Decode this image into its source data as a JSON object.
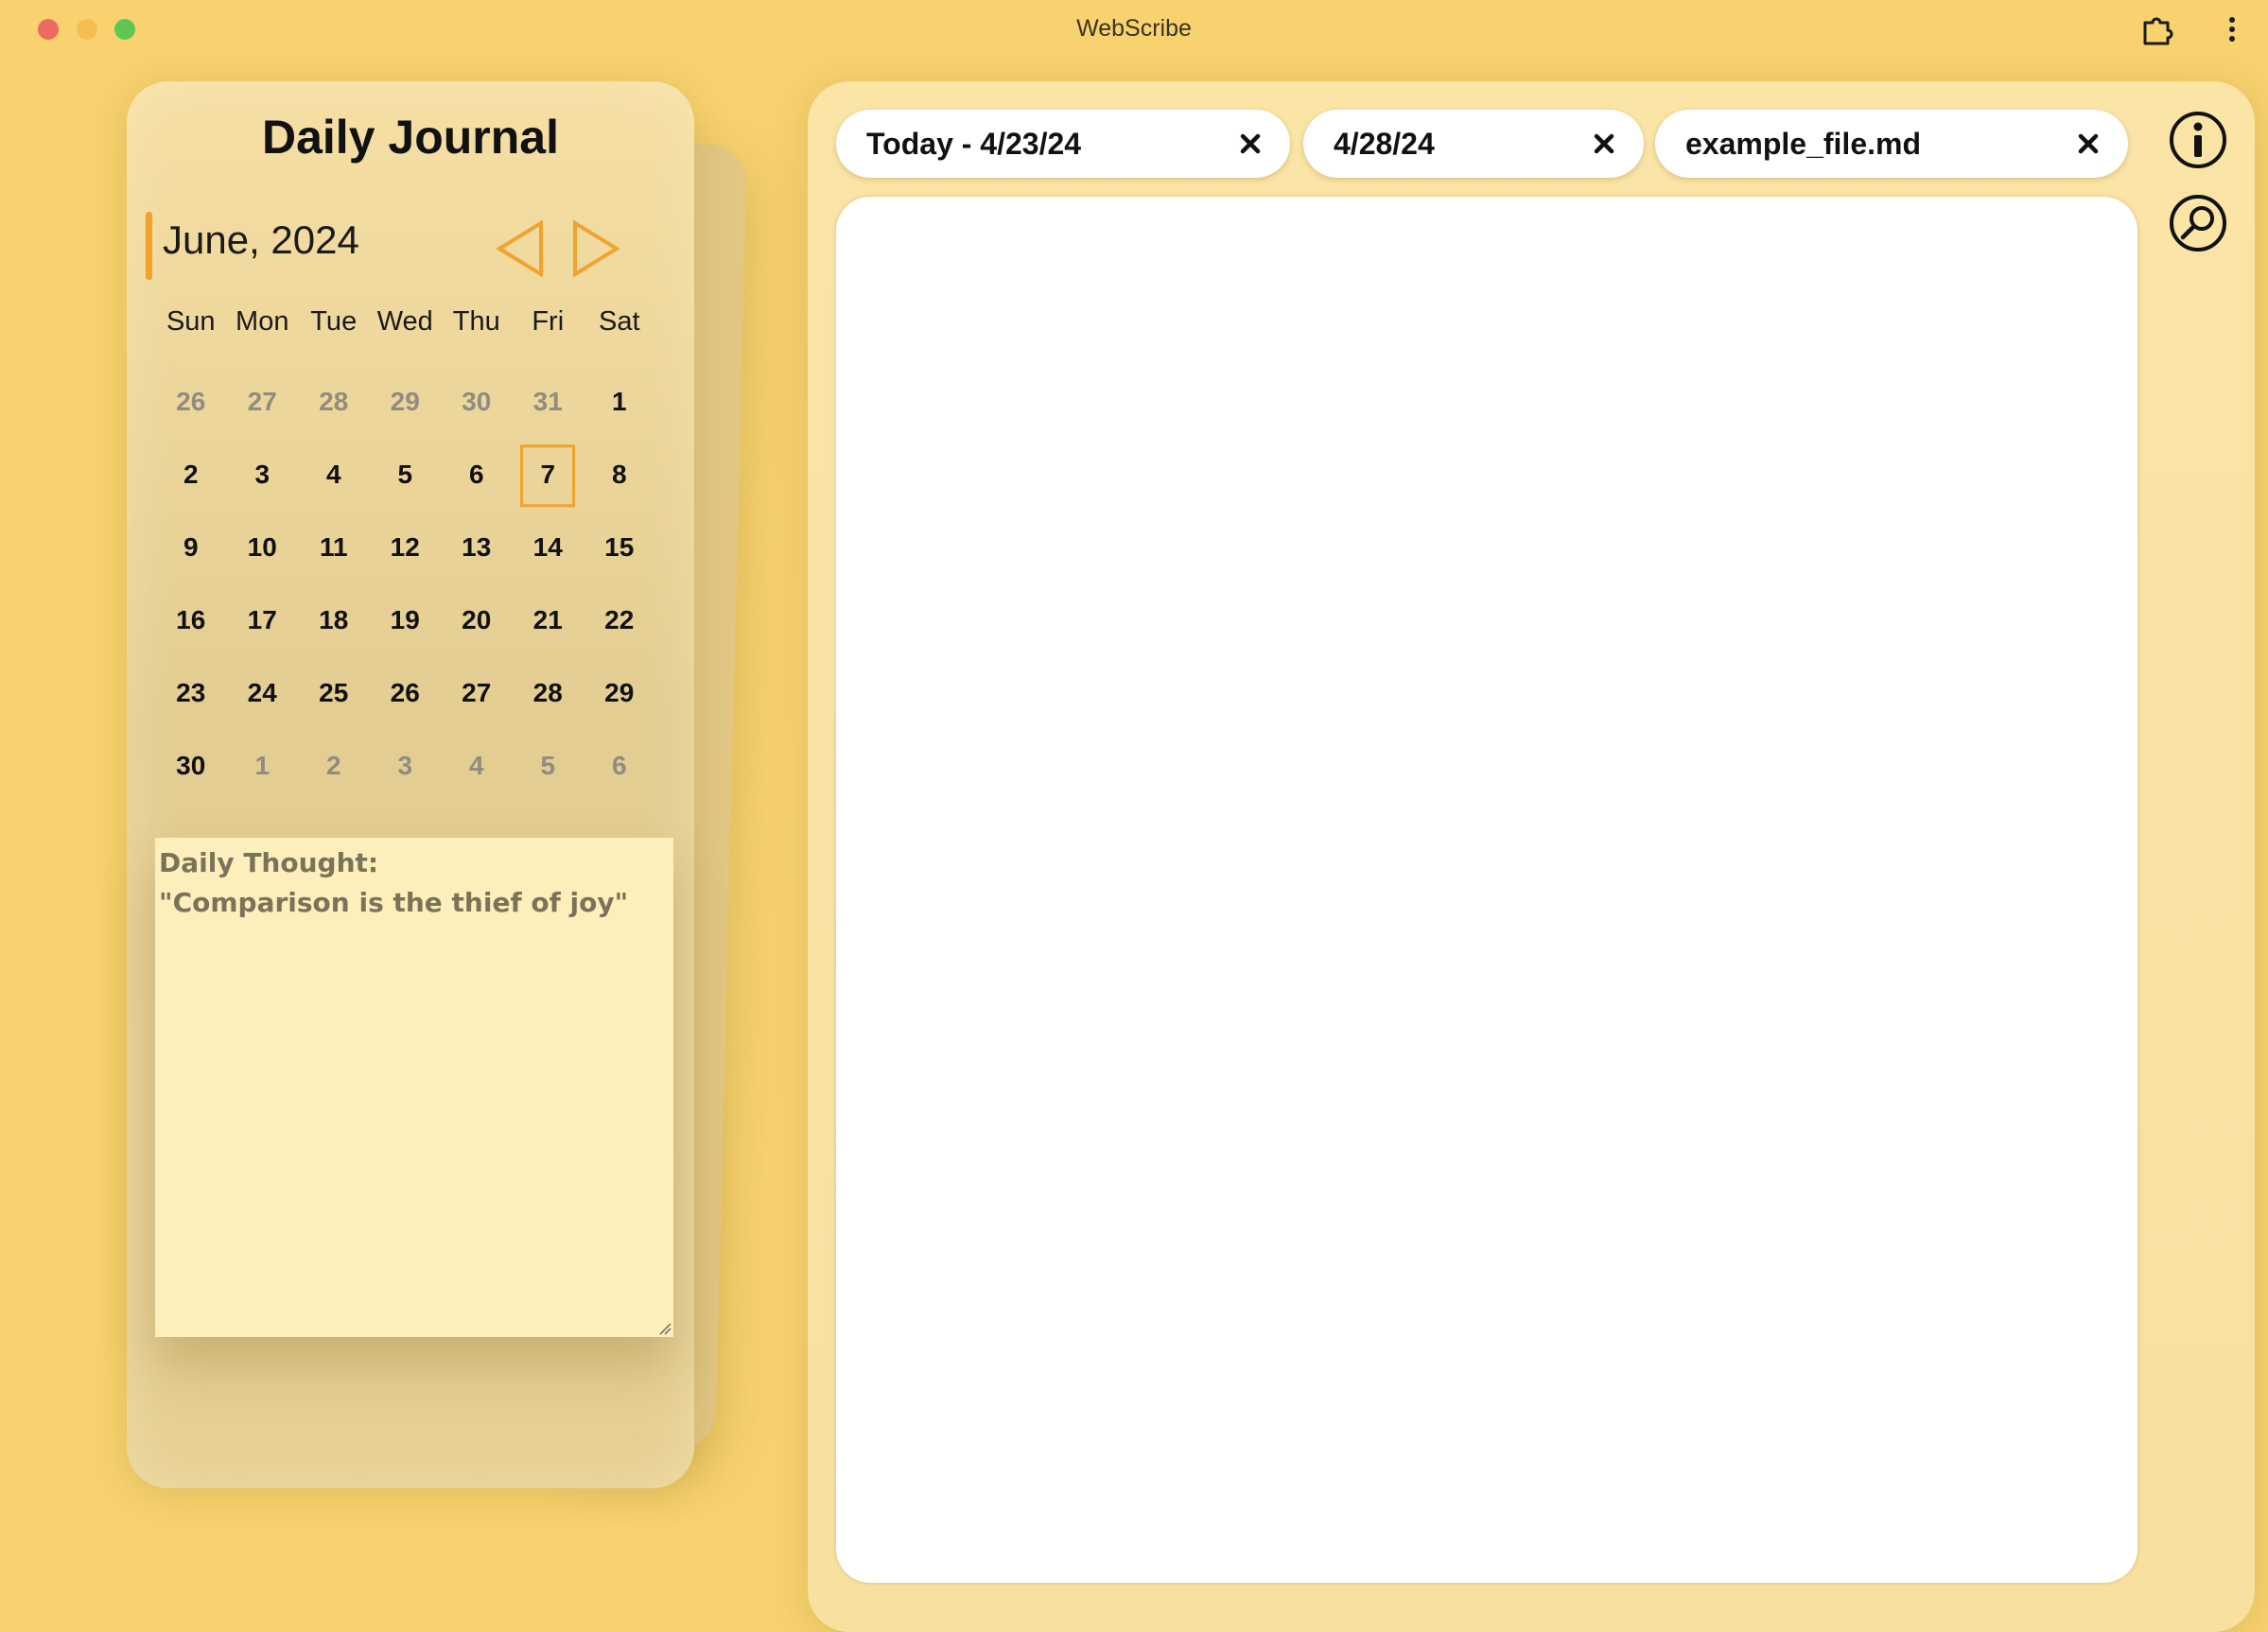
{
  "window": {
    "title": "WebScribe"
  },
  "toolbar_icons": [
    "puzzle-extension-icon",
    "vertical-ellipsis-icon"
  ],
  "journal": {
    "title": "Daily Journal",
    "month_label": "June, 2024",
    "weekdays": [
      "Sun",
      "Mon",
      "Tue",
      "Wed",
      "Thu",
      "Fri",
      "Sat"
    ],
    "weeks": [
      [
        "26",
        "27",
        "28",
        "29",
        "30",
        "31",
        "1"
      ],
      [
        "2",
        "3",
        "4",
        "5",
        "6",
        "7",
        "8"
      ],
      [
        "9",
        "10",
        "11",
        "12",
        "13",
        "14",
        "15"
      ],
      [
        "16",
        "17",
        "18",
        "19",
        "20",
        "21",
        "22"
      ],
      [
        "23",
        "24",
        "25",
        "26",
        "27",
        "28",
        "29"
      ],
      [
        "30",
        "1",
        "2",
        "3",
        "4",
        "5",
        "6"
      ]
    ],
    "selected_day": "7",
    "thought_label": "Daily Thought:",
    "thought_text": "\"Comparison is the thief of joy\"",
    "accent_color": "#f0a32e"
  },
  "editor": {
    "tabs": [
      {
        "label": "Today - 4/23/24"
      },
      {
        "label": "4/28/24"
      },
      {
        "label": "example_file.md"
      }
    ],
    "side_icons": [
      "info-icon",
      "search-icon"
    ],
    "content": ""
  },
  "colors": {
    "background": "#f7d26e",
    "panel": "#f8e0a0",
    "accent": "#f0a32e"
  }
}
